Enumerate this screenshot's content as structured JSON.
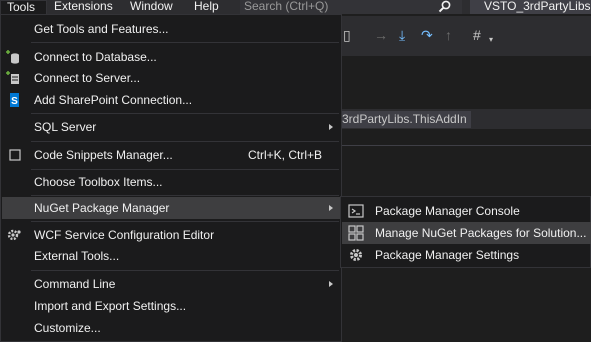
{
  "menubar": {
    "items": [
      "Tools",
      "Extensions",
      "Window",
      "Help"
    ],
    "search_placeholder": "Search (Ctrl+Q)",
    "app_title": "VSTO_3rdPartyLibs"
  },
  "document_tab": "3rdPartyLibs.ThisAddIn",
  "tools_menu": {
    "items": [
      {
        "label": "Get Tools and Features...",
        "icon": "none"
      },
      {
        "label": "Connect to Database...",
        "icon": "database-connect-icon"
      },
      {
        "label": "Connect to Server...",
        "icon": "server-connect-icon"
      },
      {
        "label": "Add SharePoint Connection...",
        "icon": "sharepoint-icon"
      },
      {
        "label": "SQL Server",
        "submenu": true
      },
      {
        "label": "Code Snippets Manager...",
        "shortcut": "Ctrl+K, Ctrl+B",
        "icon": "checkbox-icon"
      },
      {
        "label": "Choose Toolbox Items..."
      },
      {
        "label": "NuGet Package Manager",
        "submenu": true,
        "highlighted": true
      },
      {
        "label": "WCF Service Configuration Editor",
        "icon": "wcf-gear-icon"
      },
      {
        "label": "External Tools..."
      },
      {
        "label": "Command Line",
        "submenu": true
      },
      {
        "label": "Import and Export Settings..."
      },
      {
        "label": "Customize..."
      }
    ]
  },
  "nuget_submenu": {
    "items": [
      {
        "label": "Package Manager Console",
        "icon": "console-icon"
      },
      {
        "label": "Manage NuGet Packages for Solution...",
        "icon": "packages-icon",
        "highlighted": true
      },
      {
        "label": "Package Manager Settings",
        "icon": "gear-icon"
      }
    ]
  },
  "colors": {
    "menu_bg": "#1b1b1c",
    "highlight": "#3e3e40",
    "text": "#f1f1f1",
    "accent_blue": "#75beff"
  }
}
